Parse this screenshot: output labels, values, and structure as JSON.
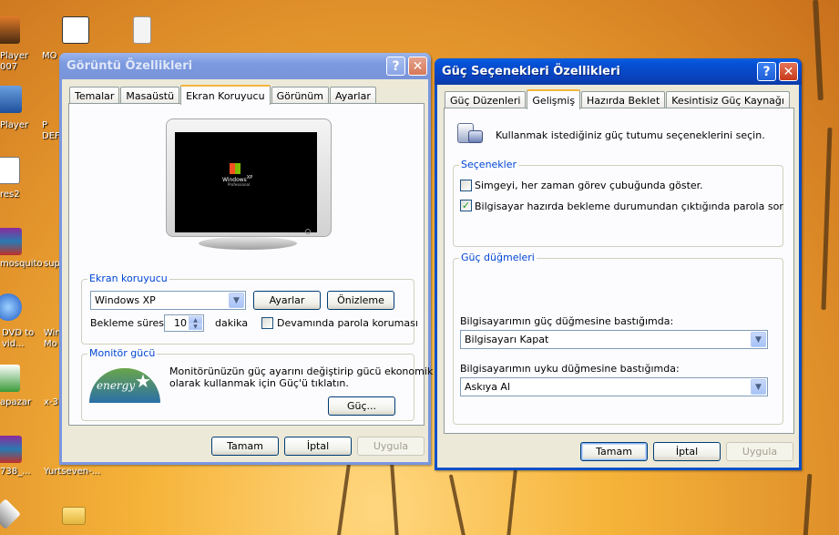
{
  "desktop": {
    "icons": [
      {
        "label": "Player\n007"
      },
      {
        "label": "MO"
      },
      {
        "label": "Player"
      },
      {
        "label": "P\nDEF"
      },
      {
        "label": "res2"
      },
      {
        "label": "mosquito"
      },
      {
        "label": "sup"
      },
      {
        "label": "DVD to\nvid..."
      },
      {
        "label": "Win\nMo"
      },
      {
        "label": "apazar"
      },
      {
        "label": "x-3"
      },
      {
        "label": "738_..."
      },
      {
        "label": "Yurtseven-..."
      }
    ]
  },
  "display_props": {
    "title": "Görüntü Özellikleri",
    "help_label": "?",
    "close_label": "✕",
    "tabs": [
      "Temalar",
      "Masaüstü",
      "Ekran Koruyucu",
      "Görünüm",
      "Ayarlar"
    ],
    "active_tab": "Ekran Koruyucu",
    "preview": {
      "logo_text": "Windows",
      "logo_sub": "XP",
      "edition": "Professional"
    },
    "screensaver_group_label": "Ekran koruyucu",
    "screensaver_value": "Windows XP",
    "settings_button": "Ayarlar",
    "preview_button": "Önizleme",
    "wait_label": "Bekleme süresi:",
    "wait_value": "10",
    "wait_unit": "dakika",
    "password_protect_label": "Devamında parola koruması",
    "password_protect_checked": false,
    "monitor_power_group_label": "Monitör gücü",
    "energy_logo_text": "energy",
    "monitor_power_text_1": "Monitörünüzün güç ayarını değiştirip gücü ekonomik",
    "monitor_power_text_2": "olarak kullanmak için Güç'ü tıklatın.",
    "power_button": "Güç...",
    "ok_button": "Tamam",
    "cancel_button": "İptal",
    "apply_button": "Uygula"
  },
  "power_props": {
    "title": "Güç Seçenekleri Özellikleri",
    "help_label": "?",
    "close_label": "✕",
    "tabs": [
      "Güç Düzenleri",
      "Gelişmiş",
      "Hazırda Beklet",
      "Kesintisiz Güç Kaynağı"
    ],
    "active_tab": "Gelişmiş",
    "intro_text": "Kullanmak istediğiniz güç tutumu seçeneklerini seçin.",
    "options_group_label": "Seçenekler",
    "option_1_label": "Simgeyi, her zaman görev çubuğunda göster.",
    "option_1_checked": false,
    "option_2_label": "Bilgisayar hazırda bekleme durumundan çıktığında parola sor",
    "option_2_checked": true,
    "buttons_group_label": "Güç düğmeleri",
    "power_button_label": "Bilgisayarımın güç düğmesine bastığımda:",
    "power_button_value": "Bilgisayarı Kapat",
    "sleep_button_label": "Bilgisayarımın uyku düğmesine bastığımda:",
    "sleep_button_value": "Askıya Al",
    "ok_button": "Tamam",
    "cancel_button": "İptal",
    "apply_button": "Uygula"
  },
  "colors": {
    "xp_blue": "#0a4fc7",
    "dialog_bg": "#ece9d8",
    "group_label": "#0046d5",
    "checkmark": "#21a121"
  }
}
